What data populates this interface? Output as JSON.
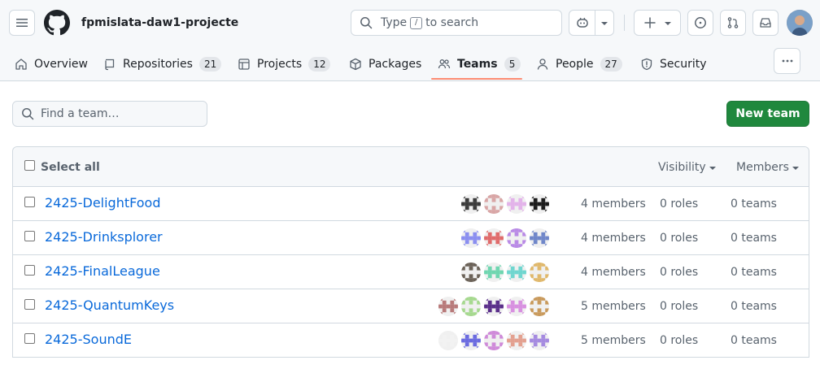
{
  "header": {
    "org_name": "fpmislata-daw1-projecte",
    "search_prefix": "Type",
    "search_key": "/",
    "search_suffix": "to search"
  },
  "nav": {
    "tabs": [
      {
        "label": "Overview",
        "icon": "book-icon"
      },
      {
        "label": "Repositories",
        "count": "21",
        "icon": "repo-icon"
      },
      {
        "label": "Projects",
        "count": "12",
        "icon": "table-icon"
      },
      {
        "label": "Packages",
        "icon": "package-icon"
      },
      {
        "label": "Teams",
        "count": "5",
        "icon": "people-icon",
        "active": true
      },
      {
        "label": "People",
        "count": "27",
        "icon": "person-icon"
      },
      {
        "label": "Security",
        "icon": "shield-icon"
      }
    ]
  },
  "toolbar": {
    "find_placeholder": "Find a team…",
    "new_team_label": "New team"
  },
  "table": {
    "select_all_label": "Select all",
    "visibility_label": "Visibility",
    "members_label": "Members",
    "rows": [
      {
        "name": "2425-DelightFood",
        "members": "4 members",
        "roles": "0 roles",
        "teams": "0 teams",
        "avatar_colors": [
          "#3b3b3b",
          "#d9a6a6",
          "#e3b3ea",
          "#1b1b1b"
        ]
      },
      {
        "name": "2425-Drinksplorer",
        "members": "4 members",
        "roles": "0 roles",
        "teams": "0 teams",
        "avatar_colors": [
          "#8a8ef0",
          "#e06b6b",
          "#b98ae6",
          "#6f86c9"
        ]
      },
      {
        "name": "2425-FinalLeague",
        "members": "4 members",
        "roles": "0 roles",
        "teams": "0 teams",
        "avatar_colors": [
          "#6b6258",
          "#6fd6b0",
          "#6fd6cf",
          "#e0b86b"
        ]
      },
      {
        "name": "2425-QuantumKeys",
        "members": "5 members",
        "roles": "0 roles",
        "teams": "0 teams",
        "avatar_colors": [
          "#b87a7a",
          "#a6d98f",
          "#5a2f8a",
          "#d890e0",
          "#c99a5c"
        ]
      },
      {
        "name": "2425-SoundE",
        "members": "5 members",
        "roles": "0 roles",
        "teams": "0 teams",
        "avatar_colors": [
          "#f2f2f2",
          "#6b6be0",
          "#cf8ad9",
          "#e3a08f",
          "#a58ae0"
        ]
      }
    ]
  }
}
